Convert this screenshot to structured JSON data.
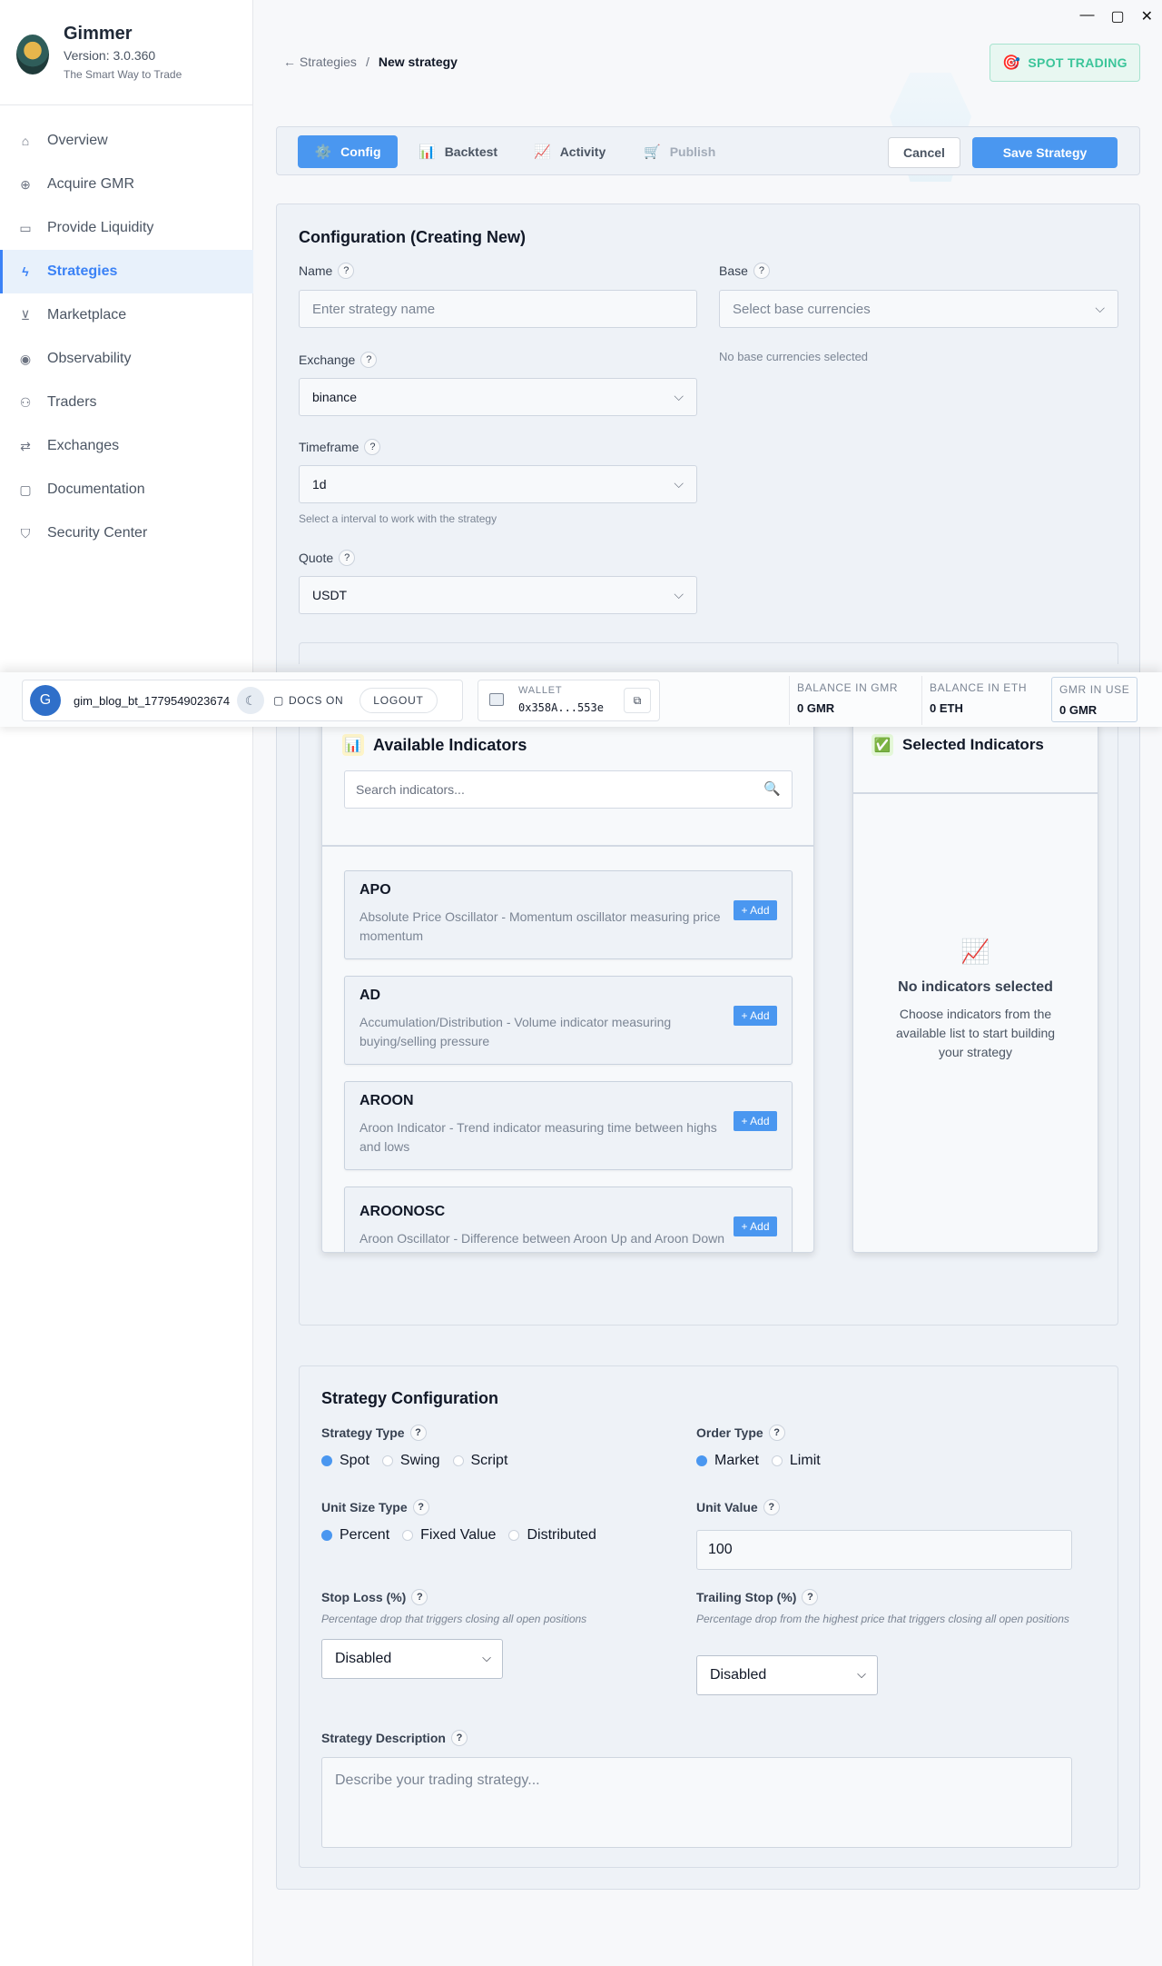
{
  "app": {
    "name": "Gimmer",
    "version": "Version: 3.0.360",
    "tagline": "The Smart Way to Trade"
  },
  "window_controls": {
    "minimize": "—",
    "maximize": "▢",
    "close": "✕"
  },
  "sidebar": {
    "items": [
      {
        "label": "Overview",
        "icon": "home-icon",
        "glyph": "⌂"
      },
      {
        "label": "Acquire GMR",
        "icon": "plus-circle-icon",
        "glyph": "⊕"
      },
      {
        "label": "Provide Liquidity",
        "icon": "card-icon",
        "glyph": "▭"
      },
      {
        "label": "Strategies",
        "icon": "lightning-icon",
        "glyph": "ϟ",
        "active": true
      },
      {
        "label": "Marketplace",
        "icon": "cart-icon",
        "glyph": "⊻"
      },
      {
        "label": "Observability",
        "icon": "eye-icon",
        "glyph": "◉"
      },
      {
        "label": "Traders",
        "icon": "users-icon",
        "glyph": "⚇"
      },
      {
        "label": "Exchanges",
        "icon": "swap-icon",
        "glyph": "⇄"
      },
      {
        "label": "Documentation",
        "icon": "chat-icon",
        "glyph": "▢"
      },
      {
        "label": "Security Center",
        "icon": "shield-icon",
        "glyph": "⛉"
      }
    ]
  },
  "header": {
    "breadcrumb_back": "← Strategies",
    "breadcrumb_sep": "/",
    "breadcrumb_current": "New strategy",
    "spot_trading": "SPOT TRADING",
    "spot_icon_glyph": "🎯"
  },
  "tabs": {
    "items": [
      {
        "label": "Config",
        "icon": "gear-icon",
        "glyph": "⚙️",
        "state": "active"
      },
      {
        "label": "Backtest",
        "icon": "bar-chart-icon",
        "glyph": "📊",
        "state": "normal"
      },
      {
        "label": "Activity",
        "icon": "line-chart-icon",
        "glyph": "📈",
        "state": "normal"
      },
      {
        "label": "Publish",
        "icon": "cart-icon",
        "glyph": "🛒",
        "state": "disabled"
      }
    ],
    "cancel": "Cancel",
    "save": "Save Strategy"
  },
  "config": {
    "title": "Configuration (Creating New)",
    "help_glyph": "?",
    "chevron": "⌵",
    "name_label": "Name",
    "name_placeholder": "Enter strategy name",
    "base_label": "Base",
    "base_placeholder": "Select base currencies",
    "base_empty": "No base currencies selected",
    "exchange_label": "Exchange",
    "exchange_value": "binance",
    "timeframe_label": "Timeframe",
    "timeframe_value": "1d",
    "timeframe_hint": "Select a interval to work with the strategy",
    "quote_label": "Quote",
    "quote_value": "USDT"
  },
  "statusbar": {
    "avatar_letter": "G",
    "username": "gim_blog_bt_1779549023674",
    "moon_glyph": "☾",
    "docs": "DOCS ON",
    "docs_glyph": "▢",
    "logout": "LOGOUT",
    "wallet_label": "WALLET",
    "wallet_value": "0x358A...553e",
    "copy_glyph": "⧉",
    "balances": [
      {
        "label": "BALANCE IN GMR",
        "value": "0 GMR"
      },
      {
        "label": "BALANCE IN ETH",
        "value": "0 ETH"
      },
      {
        "label": "GMR IN USE",
        "value": "0 GMR"
      }
    ]
  },
  "indicators": {
    "available_title": "Available Indicators",
    "available_glyph": "📊",
    "search_placeholder": "Search indicators...",
    "search_glyph": "🔍",
    "add_label": "+ Add",
    "items": [
      {
        "name": "APO",
        "desc": "Absolute Price Oscillator - Momentum oscillator measuring price momentum"
      },
      {
        "name": "AD",
        "desc": "Accumulation/Distribution - Volume indicator measuring buying/selling pressure"
      },
      {
        "name": "AROON",
        "desc": "Aroon Indicator - Trend indicator measuring time between highs and lows"
      },
      {
        "name": "AROONOSC",
        "desc": "Aroon Oscillator - Difference between Aroon Up and Aroon Down"
      }
    ],
    "selected_title": "Selected Indicators",
    "selected_glyph": "✅",
    "empty_glyph": "📈",
    "empty_title": "No indicators selected",
    "empty_desc": "Choose indicators from the available list to start building your strategy"
  },
  "strategy": {
    "title": "Strategy Configuration",
    "type_label": "Strategy Type",
    "type_options": [
      "Spot",
      "Swing",
      "Script"
    ],
    "type_selected": "Spot",
    "order_label": "Order Type",
    "order_options": [
      "Market",
      "Limit"
    ],
    "order_selected": "Market",
    "unit_type_label": "Unit Size Type",
    "unit_type_options": [
      "Percent",
      "Fixed Value",
      "Distributed"
    ],
    "unit_type_selected": "Percent",
    "unit_value_label": "Unit Value",
    "unit_value": "100",
    "stop_loss_label": "Stop Loss (%)",
    "stop_loss_hint": "Percentage drop that triggers closing all open positions",
    "stop_loss_value": "Disabled",
    "trailing_label": "Trailing Stop (%)",
    "trailing_hint": "Percentage drop from the highest price that triggers closing all open positions",
    "trailing_value": "Disabled",
    "desc_label": "Strategy Description",
    "desc_placeholder": "Describe your trading strategy..."
  },
  "colors": {
    "accent": "#4a97f0",
    "spot_trading": "#3cc59a",
    "sidebar_active_bg": "#e8f1fb"
  }
}
